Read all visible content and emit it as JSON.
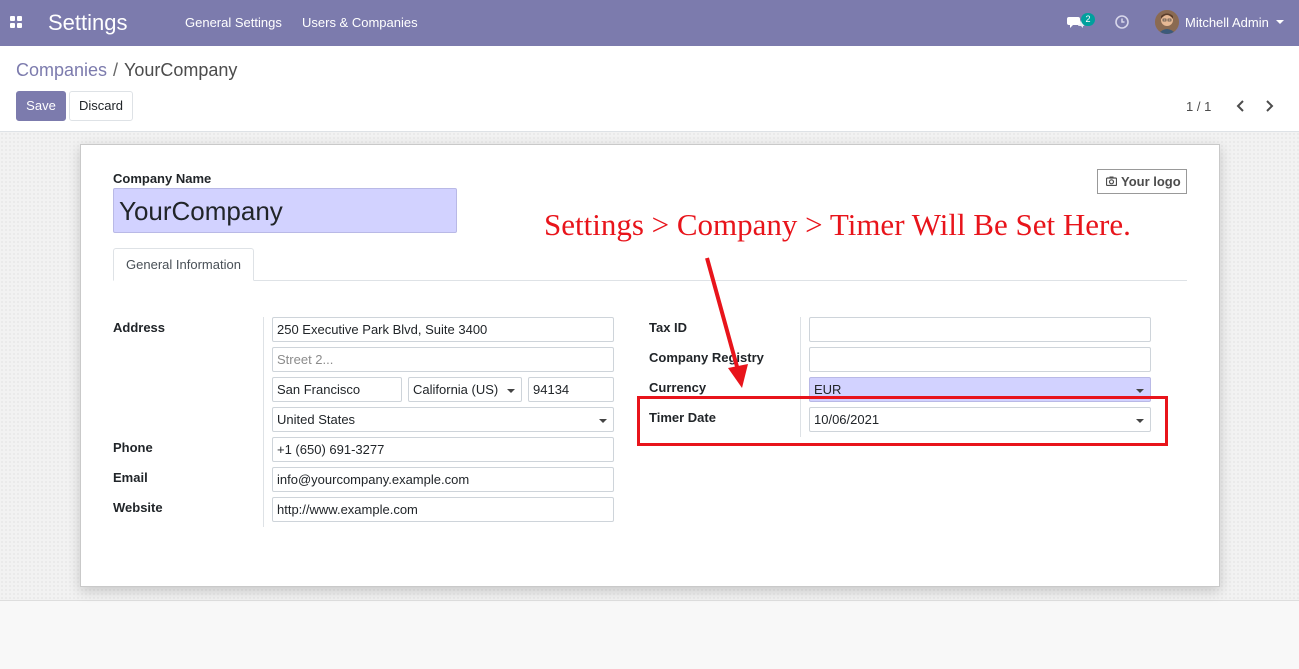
{
  "navbar": {
    "app_title": "Settings",
    "menu": [
      "General Settings",
      "Users & Companies"
    ],
    "chat_count": "2",
    "user_name": "Mitchell Admin",
    "bg_color": "#7c7bad"
  },
  "breadcrumb": {
    "parent": "Companies",
    "separator": "/",
    "current": "YourCompany"
  },
  "buttons": {
    "save": "Save",
    "discard": "Discard"
  },
  "pager": {
    "value": "1 / 1"
  },
  "form": {
    "company_name_label": "Company Name",
    "company_name": "YourCompany",
    "logo_button": "Your logo",
    "tab_general": "General Information",
    "labels": {
      "address": "Address",
      "phone": "Phone",
      "email": "Email",
      "website": "Website",
      "tax_id": "Tax ID",
      "company_registry": "Company Registry",
      "currency": "Currency",
      "timer_date": "Timer Date"
    },
    "values": {
      "street": "250 Executive Park Blvd, Suite 3400",
      "street2_placeholder": "Street 2...",
      "city": "San Francisco",
      "state": "California (US)",
      "zip": "94134",
      "country": "United States",
      "phone": "+1 (650) 691-3277",
      "email": "info@yourcompany.example.com",
      "website": "http://www.example.com",
      "tax_id": "",
      "company_registry": "",
      "currency": "EUR",
      "timer_date": "10/06/2021"
    }
  },
  "annotation": {
    "text": "Settings > Company > Timer Will Be Set Here.",
    "color": "#e8141b"
  }
}
